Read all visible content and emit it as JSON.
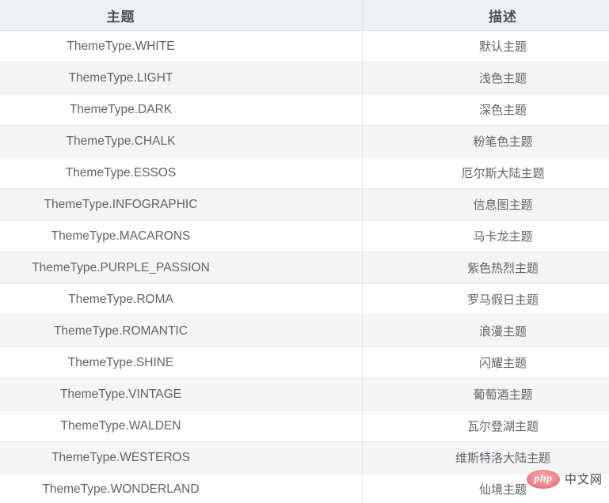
{
  "table": {
    "columns": [
      {
        "key": "theme",
        "label": "主题"
      },
      {
        "key": "desc",
        "label": "描述"
      }
    ],
    "rows": [
      {
        "theme": "ThemeType.WHITE",
        "desc": "默认主题"
      },
      {
        "theme": "ThemeType.LIGHT",
        "desc": "浅色主题"
      },
      {
        "theme": "ThemeType.DARK",
        "desc": "深色主题"
      },
      {
        "theme": "ThemeType.CHALK",
        "desc": "粉笔色主题"
      },
      {
        "theme": "ThemeType.ESSOS",
        "desc": "厄尔斯大陆主题"
      },
      {
        "theme": "ThemeType.INFOGRAPHIC",
        "desc": "信息图主题"
      },
      {
        "theme": "ThemeType.MACARONS",
        "desc": "马卡龙主题"
      },
      {
        "theme": "ThemeType.PURPLE_PASSION",
        "desc": "紫色热烈主题"
      },
      {
        "theme": "ThemeType.ROMA",
        "desc": "罗马假日主题"
      },
      {
        "theme": "ThemeType.ROMANTIC",
        "desc": "浪漫主题"
      },
      {
        "theme": "ThemeType.SHINE",
        "desc": "闪耀主题"
      },
      {
        "theme": "ThemeType.VINTAGE",
        "desc": "葡萄酒主题"
      },
      {
        "theme": "ThemeType.WALDEN",
        "desc": "瓦尔登湖主题"
      },
      {
        "theme": "ThemeType.WESTEROS",
        "desc": "维斯特洛大陆主题"
      },
      {
        "theme": "ThemeType.WONDERLAND",
        "desc": "仙境主题"
      }
    ]
  },
  "watermark": {
    "badge_text": "php",
    "site_text": "中文网",
    "badge_color": "#ef8d92",
    "text_color": "#4a4a4a"
  },
  "style": {
    "header_bg": "#edf1f4",
    "row_bg_odd": "#ffffff",
    "row_bg_even": "#f5f5f5",
    "text_color": "#5d646b",
    "header_text_color": "#4c5156",
    "border_color": "#e2e5e7"
  }
}
